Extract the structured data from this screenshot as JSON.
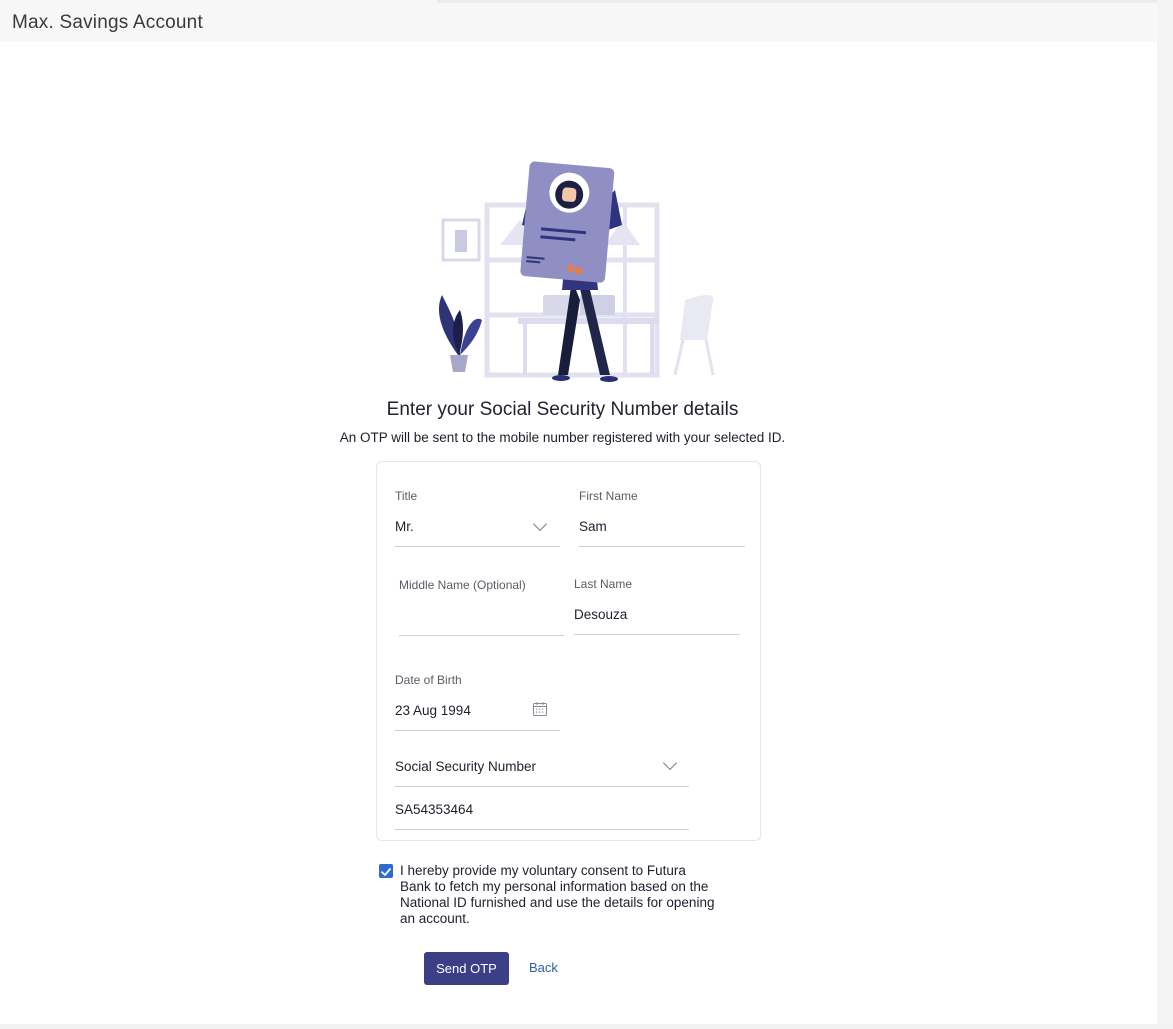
{
  "header": {
    "title": "Max. Savings Account"
  },
  "illustration": {
    "icon": "id-card-person-illustration"
  },
  "main": {
    "heading": "Enter your Social Security Number details",
    "subheading": "An OTP will be sent to the mobile number registered with your selected ID."
  },
  "form": {
    "title": {
      "label": "Title",
      "value": "Mr."
    },
    "first_name": {
      "label": "First Name",
      "value": "Sam"
    },
    "middle_name": {
      "label": "Middle Name (Optional)",
      "value": ""
    },
    "last_name": {
      "label": "Last Name",
      "value": "Desouza"
    },
    "dob": {
      "label": "Date of Birth",
      "value": "23 Aug 1994"
    },
    "id_type": {
      "value": "Social Security Number"
    },
    "id_number": {
      "value": "SA54353464"
    }
  },
  "consent": {
    "checked": true,
    "text": "I hereby provide my voluntary consent to Futura Bank to fetch my personal information based on the National ID furnished and use the details for opening an account."
  },
  "actions": {
    "send_otp_label": "Send OTP",
    "back_label": "Back"
  },
  "colors": {
    "accent": "#3b3f86",
    "link": "#2a5fa8",
    "checkbox": "#2d6bd1"
  }
}
